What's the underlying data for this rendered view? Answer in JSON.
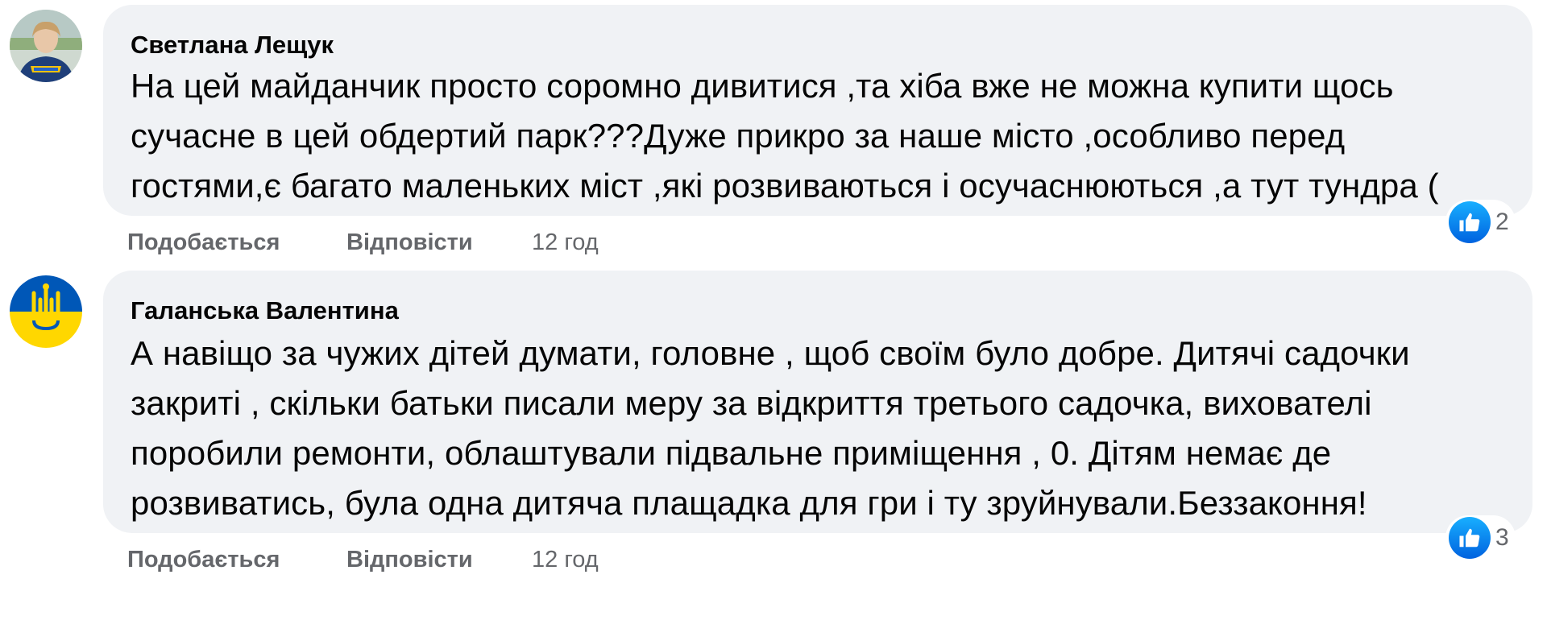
{
  "comments": [
    {
      "author": "Светлана Лещук",
      "lines": [
        "На цей майданчик просто соромно дивитися ,та хіба вже не можна купити щось",
        "сучасне в цей обдертий парк???Дуже прикро за наше місто ,особливо перед",
        "гостями,є багато маленьких міст ,які розвиваються і осучаснюються ,а тут тундра ("
      ],
      "like_label": "Подобається",
      "reply_label": "Відповісти",
      "time": "12 год",
      "reaction_count": "2",
      "avatar_icon": "user-photo-avatar"
    },
    {
      "author": "Галанська Валентина",
      "lines": [
        "А навіщо за чужих дітей думати, головне , щоб своїм було добре. Дитячі садочки",
        "закриті , скільки батьки писали меру за відкриття третього садочка, вихователі",
        "поробили ремонти, облаштували підвальне приміщення , 0. Дітям немає де",
        "розвиватись, була одна дитяча плащадка для гри і ту зруйнували.Беззаконня!"
      ],
      "like_label": "Подобається",
      "reply_label": "Відповісти",
      "time": "12 год",
      "reaction_count": "3",
      "avatar_icon": "ukraine-trident-avatar"
    }
  ],
  "colors": {
    "bubble": "#f0f2f5",
    "text": "#050505",
    "secondary": "#65676b",
    "like_blue": "#1877f2",
    "ukraine_blue": "#0057b7",
    "ukraine_yellow": "#ffd700"
  }
}
